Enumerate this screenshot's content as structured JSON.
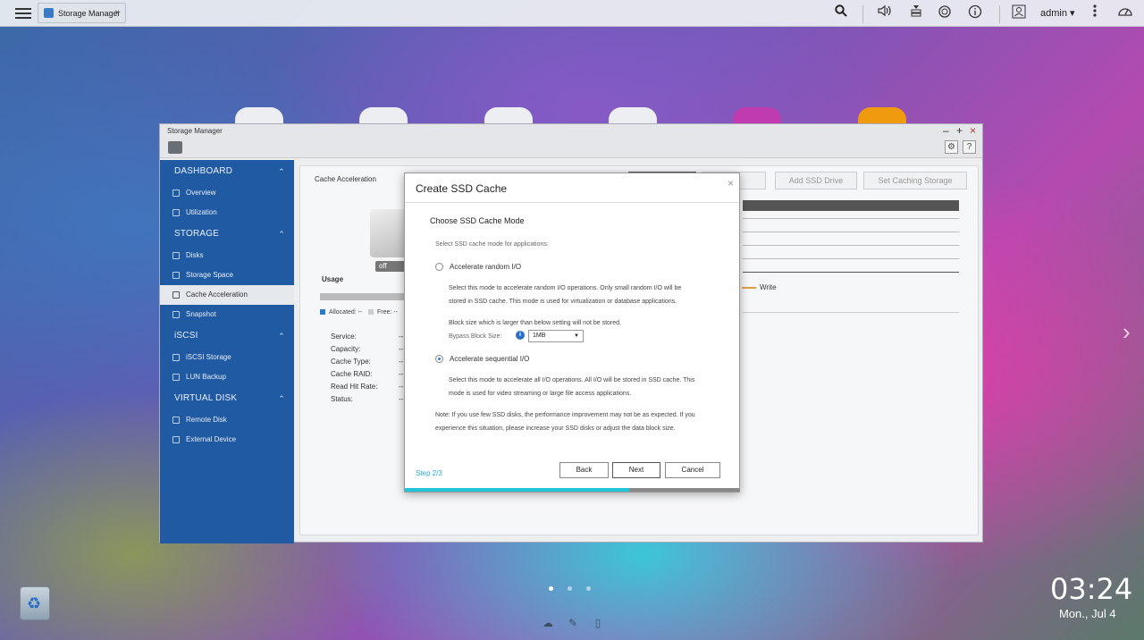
{
  "topbar": {
    "tab_label": "Storage Manager",
    "tab_close": "×",
    "user_label": "admin ▾",
    "icons": [
      "menu-icon",
      "search-icon",
      "volume-icon",
      "tasks-icon",
      "sync-icon",
      "info-icon",
      "user-icon",
      "more-icon",
      "dashboard-icon"
    ]
  },
  "window": {
    "title": "Storage Manager",
    "controls": {
      "minimize": "–",
      "maximize": "+",
      "close": "×"
    },
    "toolbar": {
      "settings_glyph": "⚙",
      "help_glyph": "?"
    }
  },
  "sidebar": {
    "sections": [
      {
        "header": "DASHBOARD",
        "items": [
          "Overview",
          "Utilization"
        ]
      },
      {
        "header": "STORAGE",
        "items": [
          "Disks",
          "Storage Space",
          "Cache Acceleration",
          "Snapshot"
        ]
      },
      {
        "header": "iSCSI",
        "items": [
          "iSCSI Storage",
          "LUN Backup"
        ]
      },
      {
        "header": "VIRTUAL DISK",
        "items": [
          "Remote Disk",
          "External Device"
        ]
      }
    ],
    "active_item": "Cache Acceleration"
  },
  "main": {
    "title": "Cache Acceleration",
    "buttons": {
      "remove": "ve",
      "add_ssd": "Add SSD Drive",
      "set_caching": "Set Caching Storage"
    },
    "toggle": "off",
    "usage_label": "Usage",
    "legend": {
      "allocated": "Allocated: --",
      "free": "Free: --"
    },
    "info_rows": [
      {
        "label": "Service:",
        "value": "--"
      },
      {
        "label": "Capacity:",
        "value": "--"
      },
      {
        "label": "Cache Type:",
        "value": "--"
      },
      {
        "label": "Cache RAID:",
        "value": "--"
      },
      {
        "label": "Read Hit Rate:",
        "value": "--"
      },
      {
        "label": "Status:",
        "value": "--"
      }
    ],
    "write_legend": "Write"
  },
  "modal": {
    "title": "Create SSD Cache",
    "close": "×",
    "subtitle": "Choose SSD Cache Mode",
    "instruction": "Select SSD cache mode for applications:",
    "option_random": "Accelerate random I/O",
    "random_desc_1": "Select this mode to accelerate random I/O operations. Only small random I/O will be",
    "random_desc_2": "stored in SSD cache. This mode is used for virtualization or database applications.",
    "block_desc": "Block size which is larger than below setting will not be stored.",
    "bypass_label": "Bypass Block Size:",
    "bypass_value": "1MB",
    "option_sequential": "Accelerate sequential I/O",
    "sequential_desc_1": "Select this mode to accelerate all I/O operations. All I/O will be stored in SSD cache. This",
    "sequential_desc_2": "mode is used for video streaming or large file access applications.",
    "note_1": "Note: If you use few SSD disks, the performance improvement may not be as expected. If you",
    "note_2": "experience this situation, please increase your SSD disks or adjust the data block size.",
    "step": "Step 2/3",
    "back": "Back",
    "next": "Next",
    "cancel": "Cancel",
    "selected_mode": "sequential",
    "progress_fraction": 0.67,
    "accent_color": "#22c4d8"
  },
  "desktop": {
    "clock": "03:24",
    "date": "Mon., Jul 4",
    "page_count": 3,
    "current_page": 1
  }
}
